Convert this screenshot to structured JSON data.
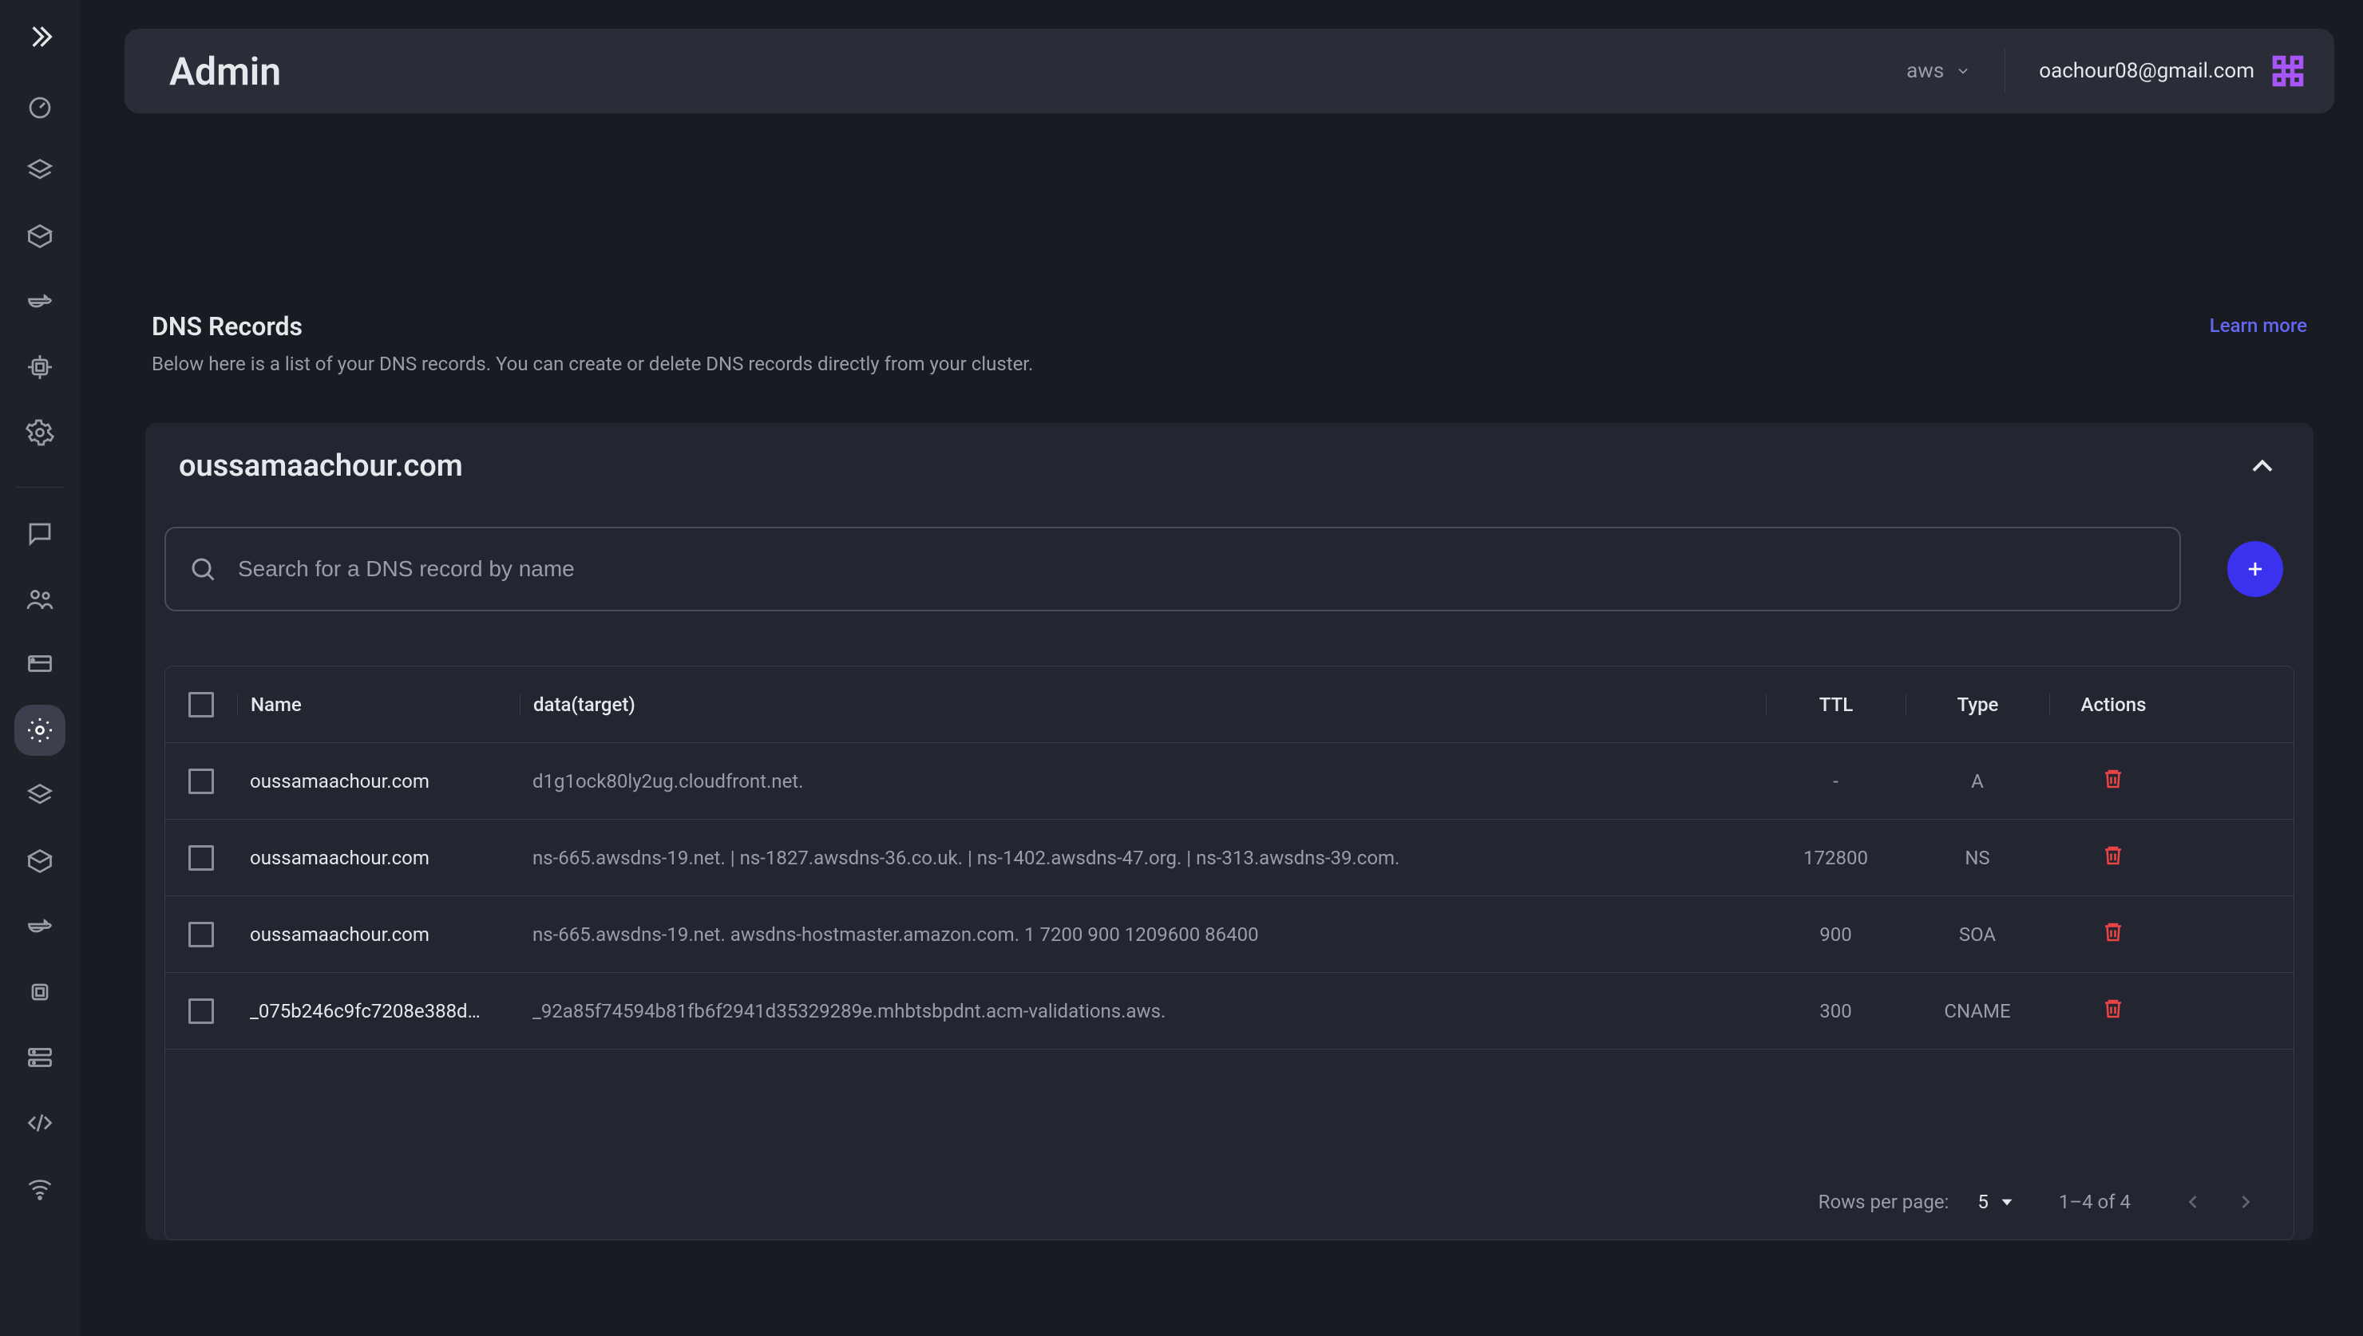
{
  "header": {
    "title": "Admin",
    "env_label": "aws",
    "user_email": "oachour08@gmail.com"
  },
  "sidebar_icons": [
    "dashboard-icon",
    "layers-icon",
    "box-icon",
    "docker-icon",
    "memory-icon",
    "gear-icon"
  ],
  "sidebar_bottom_icons": [
    "feedback-icon",
    "people-icon",
    "workspace-icon",
    "dns-icon",
    "layers2-icon",
    "box2-icon",
    "docker2-icon",
    "memory2-icon",
    "storage-icon",
    "code-icon",
    "wifi-icon"
  ],
  "sidebar_active_index": 3,
  "panel": {
    "title": "DNS Records",
    "subtitle": "Below here is a list of your DNS records. You can create or delete DNS records directly from your cluster.",
    "learn_more": "Learn more",
    "domain": "oussamaachour.com"
  },
  "search": {
    "placeholder": "Search for a DNS record by name"
  },
  "columns": {
    "name": "Name",
    "data": "data(target)",
    "ttl": "TTL",
    "type": "Type",
    "actions": "Actions"
  },
  "rows": [
    {
      "name": "oussamaachour.com",
      "data": "d1g1ock80ly2ug.cloudfront.net.",
      "ttl": "-",
      "type": "A"
    },
    {
      "name": "oussamaachour.com",
      "data": "ns-665.awsdns-19.net. | ns-1827.awsdns-36.co.uk. | ns-1402.awsdns-47.org. | ns-313.awsdns-39.com.",
      "ttl": "172800",
      "type": "NS"
    },
    {
      "name": "oussamaachour.com",
      "data": "ns-665.awsdns-19.net. awsdns-hostmaster.amazon.com. 1 7200 900 1209600 86400",
      "ttl": "900",
      "type": "SOA"
    },
    {
      "name": "_075b246c9fc7208e388d…",
      "data": "_92a85f74594b81fb6f2941d35329289e.mhbtsbpdnt.acm-validations.aws.",
      "ttl": "300",
      "type": "CNAME"
    }
  ],
  "footer": {
    "rpp_label": "Rows per page:",
    "rpp_value": "5",
    "range": "1–4 of 4"
  }
}
